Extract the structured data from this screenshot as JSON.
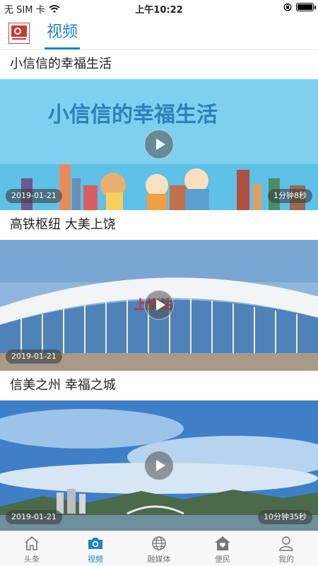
{
  "status": {
    "carrier": "无 SIM 卡",
    "time": "上午10:22"
  },
  "header": {
    "tab": "视频"
  },
  "videos": [
    {
      "title": "小信信的幸福生活",
      "banner": "小信信的幸福生活",
      "date": "2019-01-21",
      "duration": "1分钟8秒"
    },
    {
      "title": "高铁枢纽 大美上饶",
      "sign": "上饶站",
      "date": "2019-01-21"
    },
    {
      "title": "信美之州 幸福之城",
      "date": "2019-01-21",
      "duration": "10分钟35秒"
    }
  ],
  "tabbar": [
    {
      "label": "头条",
      "icon": "home-icon"
    },
    {
      "label": "视频",
      "icon": "camera-icon",
      "active": true
    },
    {
      "label": "融媒体",
      "icon": "globe-icon"
    },
    {
      "label": "便民",
      "icon": "house-heart-icon"
    },
    {
      "label": "我的",
      "icon": "user-icon"
    }
  ],
  "colors": {
    "accent": "#1b84c7"
  }
}
